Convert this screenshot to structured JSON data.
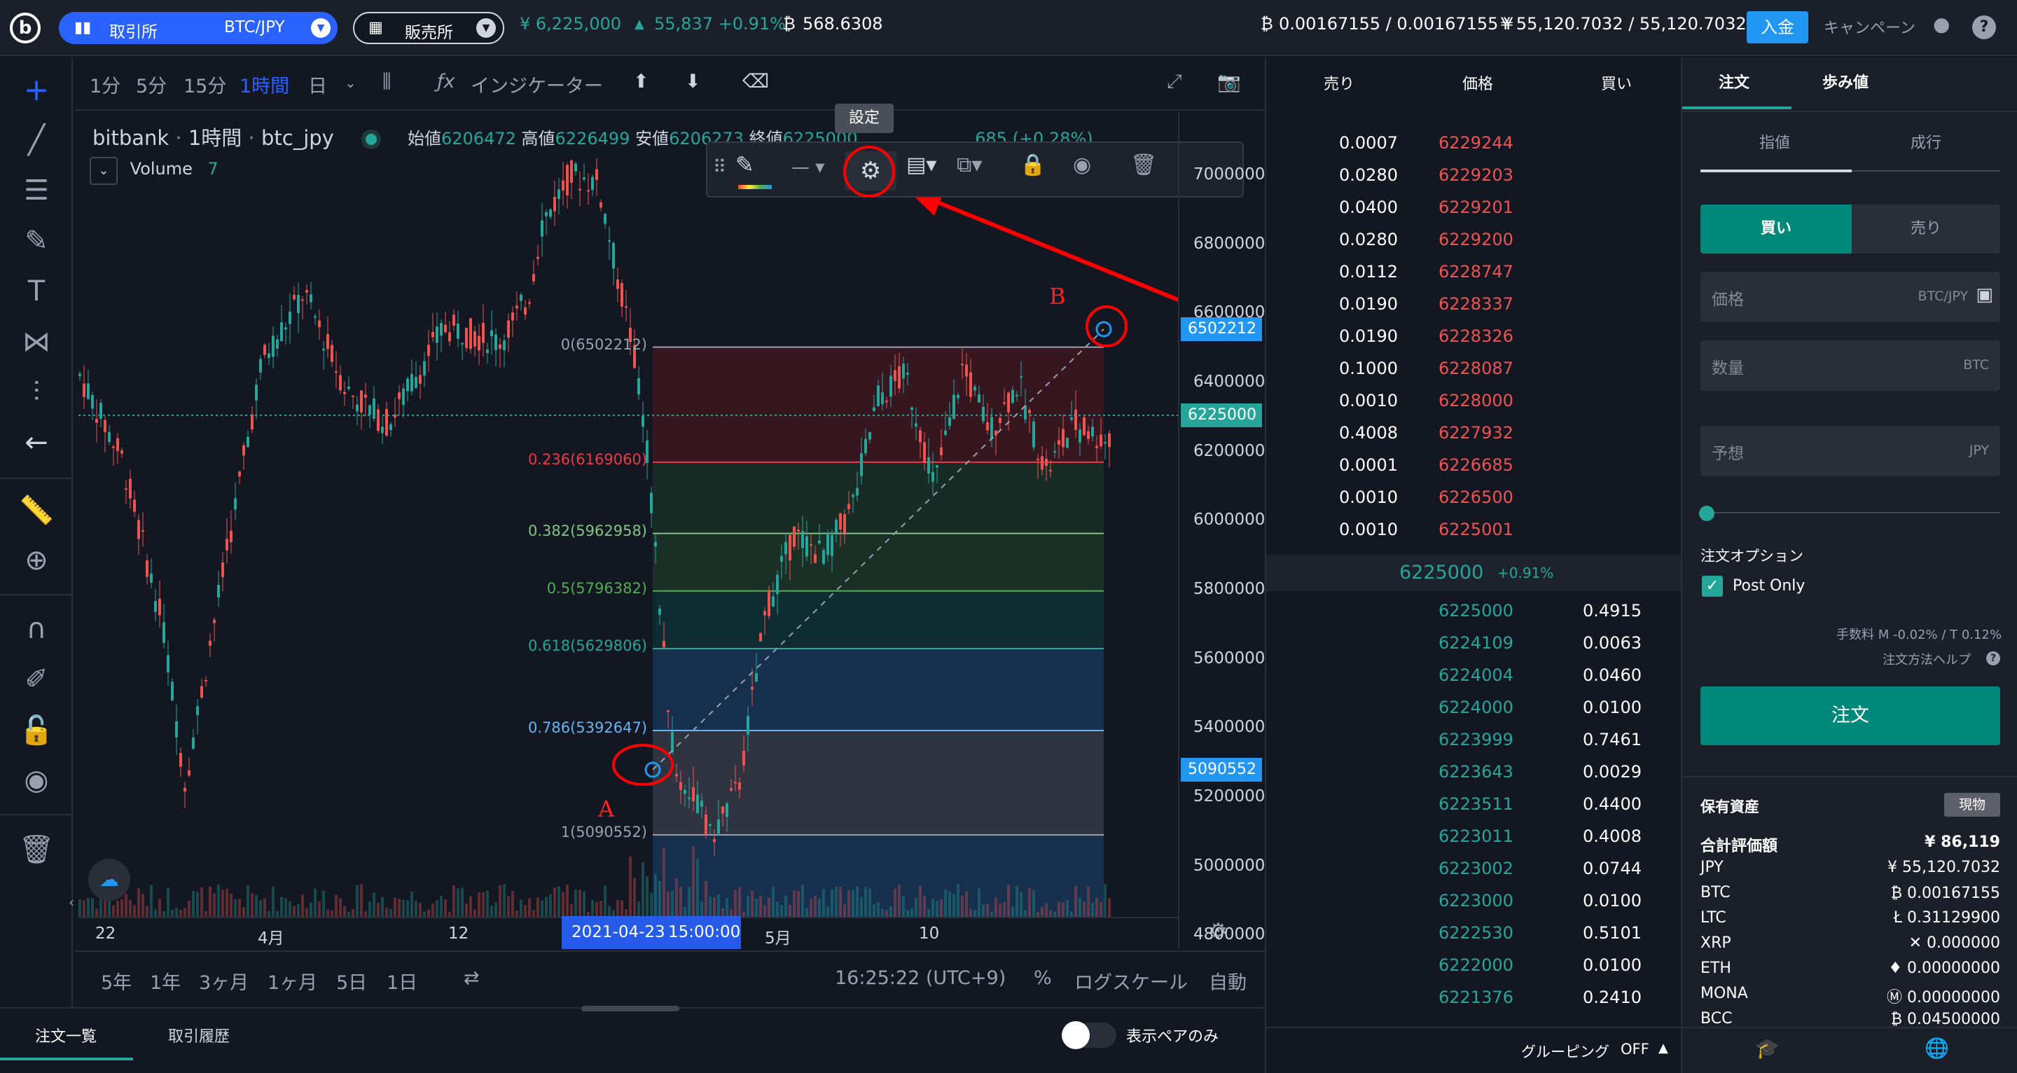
{
  "header": {
    "exchange_label": "取引所",
    "pair": "BTC/JPY",
    "broker_label": "販売所",
    "last_price": "¥ 6,225,000",
    "change": "55,837 +0.91%",
    "btc_volume": "568.6308",
    "btc_balance": "0.00167155 / 0.00167155",
    "jpy_balance": "¥ 55,120.7032 / 55,120.7032",
    "deposit": "入金",
    "campaign": "キャンペーン"
  },
  "chart_toolbar": {
    "timeframes": [
      "1分",
      "5分",
      "15分",
      "1時間",
      "日"
    ],
    "active": "1時間",
    "indicators": "インジケーター"
  },
  "legend": {
    "source": "bitbank",
    "interval": "1時間",
    "symbol": "btc_jpy",
    "open_label": "始値",
    "open": "6206472",
    "high_label": "高値",
    "high": "6226499",
    "low_label": "安値",
    "low": "6206273",
    "close_label": "終値",
    "close": "6225000",
    "change_tail": "685 (+0.28%)",
    "volume_label": "Volume",
    "volume_value": "7"
  },
  "drawing_toolbar": {
    "tooltip": "設定"
  },
  "fib_levels": [
    {
      "label": "0(6502212)",
      "color": "#9aa0ae",
      "value": 6502212
    },
    {
      "label": "0.236(6169060)",
      "color": "#f23645",
      "value": 6169060
    },
    {
      "label": "0.382(5962958)",
      "color": "#81c784",
      "value": 5962958
    },
    {
      "label": "0.5(5796382)",
      "color": "#4caf50",
      "value": 5796382
    },
    {
      "label": "0.618(5629806)",
      "color": "#26a69a",
      "value": 5629806
    },
    {
      "label": "0.786(5392647)",
      "color": "#64b5f6",
      "value": 5392647
    },
    {
      "label": "1(5090552)",
      "color": "#9aa0ae",
      "value": 5090552
    }
  ],
  "annotations": {
    "a": "A",
    "b": "B"
  },
  "y_axis": {
    "ticks": [
      "7000000",
      "6800000",
      "6600000",
      "6400000",
      "6200000",
      "6000000",
      "5800000",
      "5600000",
      "5400000",
      "5200000",
      "5000000",
      "4800000"
    ],
    "tag_top": "6502212",
    "tag_current": "6225000",
    "tag_bottom": "5090552"
  },
  "x_axis": {
    "ticks": [
      "22",
      "4月",
      "12",
      "5月",
      "10"
    ],
    "cursor_date": "2021-04-23",
    "cursor_time": "15:00:00"
  },
  "bottom_bar": {
    "ranges": [
      "5年",
      "1年",
      "3ヶ月",
      "1ヶ月",
      "5日",
      "1日"
    ],
    "clock": "16:25:22 (UTC+9)",
    "percent": "%",
    "log": "ログスケール",
    "auto": "自動"
  },
  "footer": {
    "tab_orders": "注文一覧",
    "tab_history": "取引履歴",
    "toggle_label": "表示ペアのみ"
  },
  "orderbook": {
    "col_sell": "売り",
    "col_price": "価格",
    "col_buy": "買い",
    "asks": [
      [
        "0.0007",
        "6229244"
      ],
      [
        "0.0280",
        "6229203"
      ],
      [
        "0.0400",
        "6229201"
      ],
      [
        "0.0280",
        "6229200"
      ],
      [
        "0.0112",
        "6228747"
      ],
      [
        "0.0190",
        "6228337"
      ],
      [
        "0.0190",
        "6228326"
      ],
      [
        "0.1000",
        "6228087"
      ],
      [
        "0.0010",
        "6228000"
      ],
      [
        "0.4008",
        "6227932"
      ],
      [
        "0.0001",
        "6226685"
      ],
      [
        "0.0010",
        "6226500"
      ],
      [
        "0.0010",
        "6225001"
      ]
    ],
    "mid_price": "6225000",
    "mid_change": "+0.91%",
    "bids": [
      [
        "6225000",
        "0.4915"
      ],
      [
        "6224109",
        "0.0063"
      ],
      [
        "6224004",
        "0.0460"
      ],
      [
        "6224000",
        "0.0100"
      ],
      [
        "6223999",
        "0.7461"
      ],
      [
        "6223643",
        "0.0029"
      ],
      [
        "6223511",
        "0.4400"
      ],
      [
        "6223011",
        "0.4008"
      ],
      [
        "6223002",
        "0.0744"
      ],
      [
        "6223000",
        "0.0100"
      ],
      [
        "6222530",
        "0.5101"
      ],
      [
        "6222000",
        "0.0100"
      ],
      [
        "6221376",
        "0.2410"
      ]
    ],
    "grouping": "グルーピング",
    "grouping_state": "OFF"
  },
  "order_panel": {
    "tab_order": "注文",
    "tab_trades": "歩み値",
    "type_limit": "指値",
    "type_market": "成行",
    "buy": "買い",
    "sell": "売り",
    "price_label": "価格",
    "price_unit": "BTC/JPY",
    "qty_label": "数量",
    "qty_unit": "BTC",
    "est_label": "予想",
    "est_unit": "JPY",
    "options_label": "注文オプション",
    "post_only": "Post Only",
    "fee": "手数料 M -0.02% / T 0.12%",
    "help": "注文方法ヘルプ",
    "submit": "注文",
    "assets_title": "保有資産",
    "assets_badge": "現物",
    "total_label": "合計評価額",
    "total_value": "¥ 86,119",
    "assets": [
      [
        "JPY",
        "¥ 55,120.7032"
      ],
      [
        "BTC",
        "₿ 0.00167155"
      ],
      [
        "LTC",
        "Ł 0.31129900"
      ],
      [
        "XRP",
        "✕ 0.000000"
      ],
      [
        "ETH",
        "♦ 0.00000000"
      ],
      [
        "MONA",
        "Ⓜ 0.00000000"
      ],
      [
        "BCC",
        "₿ 0.04500000"
      ]
    ]
  },
  "colors": {
    "up": "#26a69a",
    "down": "#ef5350",
    "accent": "#2962ff",
    "green_btn": "#00897b"
  }
}
